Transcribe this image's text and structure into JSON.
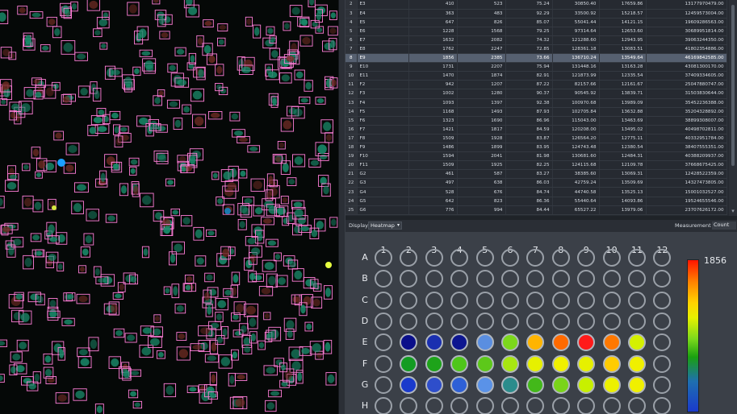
{
  "table": {
    "rows": [
      {
        "n": "2",
        "well": "E3",
        "c1": "410",
        "c2": "523",
        "c3": "75.24",
        "c4": "30850.40",
        "c5": "17659.86",
        "c6": "13177970479.00"
      },
      {
        "n": "3",
        "well": "E4",
        "c1": "363",
        "c2": "483",
        "c3": "92.29",
        "c4": "33500.92",
        "c5": "15218.57",
        "c6": "12459573004.00"
      },
      {
        "n": "4",
        "well": "E5",
        "c1": "647",
        "c2": "826",
        "c3": "85.07",
        "c4": "55041.44",
        "c5": "14121.15",
        "c6": "19609286563.00"
      },
      {
        "n": "5",
        "well": "E6",
        "c1": "1228",
        "c2": "1568",
        "c3": "79.25",
        "c4": "97314.64",
        "c5": "12653.60",
        "c6": "30689951814.00"
      },
      {
        "n": "6",
        "well": "E7",
        "c1": "1632",
        "c2": "2082",
        "c3": "74.32",
        "c4": "121288.60",
        "c5": "12943.95",
        "c6": "39063244350.00"
      },
      {
        "n": "7",
        "well": "E8",
        "c1": "1762",
        "c2": "2247",
        "c3": "72.85",
        "c4": "128361.18",
        "c5": "13083.51",
        "c6": "41802354886.00"
      },
      {
        "n": "8",
        "well": "E9",
        "c1": "1856",
        "c2": "2385",
        "c3": "73.66",
        "c4": "136710.24",
        "c5": "13549.64",
        "c6": "46169842585.00"
      },
      {
        "n": "9",
        "well": "E10",
        "c1": "1731",
        "c2": "2207",
        "c3": "75.94",
        "c4": "131448.16",
        "c5": "13163.28",
        "c6": "43081300170.00"
      },
      {
        "n": "10",
        "well": "E11",
        "c1": "1470",
        "c2": "1874",
        "c3": "82.91",
        "c4": "121873.99",
        "c5": "12335.54",
        "c6": "37409334605.00"
      },
      {
        "n": "11",
        "well": "F2",
        "c1": "942",
        "c2": "1207",
        "c3": "87.22",
        "c4": "82157.66",
        "c5": "12161.67",
        "c6": "25047880747.00"
      },
      {
        "n": "12",
        "well": "F3",
        "c1": "1002",
        "c2": "1280",
        "c3": "90.37",
        "c4": "90545.92",
        "c5": "13839.71",
        "c6": "31503830644.00"
      },
      {
        "n": "13",
        "well": "F4",
        "c1": "1093",
        "c2": "1397",
        "c3": "92.38",
        "c4": "100970.68",
        "c5": "13989.09",
        "c6": "35452236388.00"
      },
      {
        "n": "14",
        "well": "F5",
        "c1": "1168",
        "c2": "1493",
        "c3": "87.93",
        "c4": "102705.84",
        "c5": "13632.88",
        "c6": "35204328892.00"
      },
      {
        "n": "15",
        "well": "F6",
        "c1": "1323",
        "c2": "1690",
        "c3": "86.96",
        "c4": "115043.00",
        "c5": "13463.69",
        "c6": "38899308007.00"
      },
      {
        "n": "16",
        "well": "F7",
        "c1": "1421",
        "c2": "1817",
        "c3": "84.59",
        "c4": "120208.00",
        "c5": "13495.02",
        "c6": "40498702811.00"
      },
      {
        "n": "17",
        "well": "F8",
        "c1": "1509",
        "c2": "1928",
        "c3": "83.87",
        "c4": "126564.20",
        "c5": "12775.11",
        "c6": "40332951784.00"
      },
      {
        "n": "18",
        "well": "F9",
        "c1": "1486",
        "c2": "1899",
        "c3": "83.95",
        "c4": "124743.48",
        "c5": "12380.54",
        "c6": "38407555351.00"
      },
      {
        "n": "19",
        "well": "F10",
        "c1": "1594",
        "c2": "2041",
        "c3": "81.98",
        "c4": "130681.60",
        "c5": "12484.31",
        "c6": "40388209937.00"
      },
      {
        "n": "20",
        "well": "F11",
        "c1": "1509",
        "c2": "1925",
        "c3": "82.25",
        "c4": "124115.68",
        "c5": "12109.78",
        "c6": "37668675425.00"
      },
      {
        "n": "21",
        "well": "G2",
        "c1": "461",
        "c2": "587",
        "c3": "83.27",
        "c4": "38385.60",
        "c5": "13069.31",
        "c6": "12428522359.00"
      },
      {
        "n": "22",
        "well": "G3",
        "c1": "497",
        "c2": "638",
        "c3": "86.03",
        "c4": "42759.24",
        "c5": "13509.69",
        "c6": "14327473805.00"
      },
      {
        "n": "23",
        "well": "G4",
        "c1": "528",
        "c2": "676",
        "c3": "84.74",
        "c4": "44740.58",
        "c5": "13525.13",
        "c6": "15001032527.00"
      },
      {
        "n": "24",
        "well": "G5",
        "c1": "642",
        "c2": "823",
        "c3": "86.36",
        "c4": "55440.64",
        "c5": "14093.86",
        "c6": "19524655546.00"
      },
      {
        "n": "25",
        "well": "G6",
        "c1": "776",
        "c2": "994",
        "c3": "84.44",
        "c4": "65527.22",
        "c5": "13979.06",
        "c6": "23707626172.00"
      }
    ],
    "selected_row": 6
  },
  "toolbar": {
    "display_label": "Display",
    "display_value": "Heatmap",
    "measurement_label": "Measurement",
    "measurement_value": "Count"
  },
  "plate": {
    "columns": [
      "1",
      "2",
      "3",
      "4",
      "5",
      "6",
      "7",
      "8",
      "9",
      "10",
      "11",
      "12"
    ],
    "rows": [
      "A",
      "B",
      "C",
      "D",
      "E",
      "F",
      "G",
      "H"
    ],
    "scale_max": "1856",
    "filled": {
      "E": [
        null,
        "#0a0f8a",
        "#1a2fb0",
        "#0d1690",
        "#5a8ee0",
        "#7cd81c",
        "#ffb400",
        "#ff6a00",
        "#ff1a1a",
        "#ff7800",
        "#d4f000",
        null
      ],
      "F": [
        null,
        "#139c22",
        "#1ea31a",
        "#4fc61a",
        "#5dc81a",
        "#a8e612",
        "#e6f000",
        "#f0f000",
        "#e6f000",
        "#ffcc00",
        "#f0f000",
        null
      ],
      "G": [
        null,
        "#1a3acc",
        "#2e4ecb",
        "#2e60d6",
        "#5a92e8",
        "#2b8c8c",
        "#43b81a",
        "#7ad41a",
        "#c8f000",
        "#ecf000",
        "#f0f000",
        null
      ],
      "H": [
        null,
        null,
        null,
        null,
        null,
        null,
        null,
        null,
        null,
        null,
        null,
        null
      ]
    },
    "empty_color": "transparent"
  },
  "cells": {
    "box_color": "#ff7fd8",
    "cell_color": "#1a8a6a",
    "highlight_blue": "#1aa0ff",
    "highlight_yellow": "#e6ff40"
  }
}
